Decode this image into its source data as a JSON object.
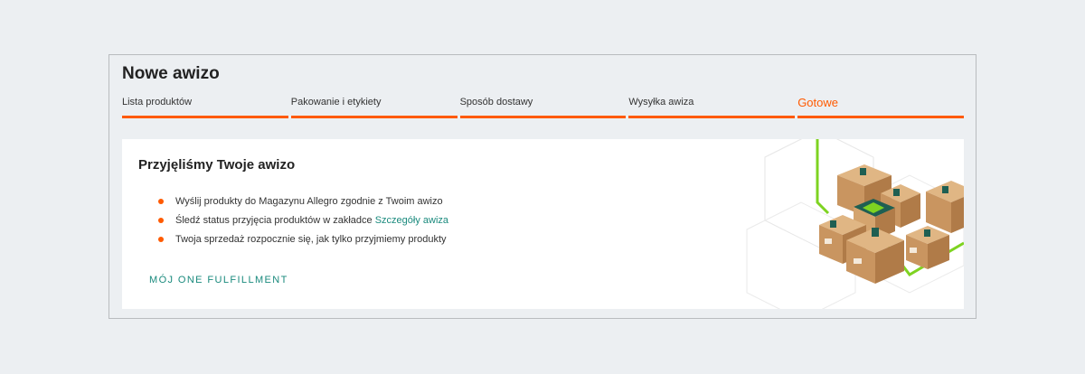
{
  "page": {
    "title": "Nowe awizo"
  },
  "steps": [
    {
      "label": "Lista produktów"
    },
    {
      "label": "Pakowanie i etykiety"
    },
    {
      "label": "Sposób dostawy"
    },
    {
      "label": "Wysyłka awiza"
    },
    {
      "label": "Gotowe",
      "active": true
    }
  ],
  "card": {
    "title": "Przyjęliśmy Twoje awizo",
    "bullets": [
      {
        "text": "Wyślij produkty do Magazynu Allegro zgodnie z Twoim awizo"
      },
      {
        "text": "Śledź status przyjęcia produktów w zakładce ",
        "link": "Szczegóły awiza"
      },
      {
        "text": "Twoja sprzedaż rozpocznie się, jak tylko przyjmiemy produkty"
      }
    ],
    "cta": "MÓJ ONE FULFILLMENT",
    "illustration_icon": "stacked-boxes-illustration"
  },
  "colors": {
    "accent": "#ff5a00",
    "link": "#1a8a7d",
    "line": "#7ed321",
    "background": "#eceff2"
  }
}
